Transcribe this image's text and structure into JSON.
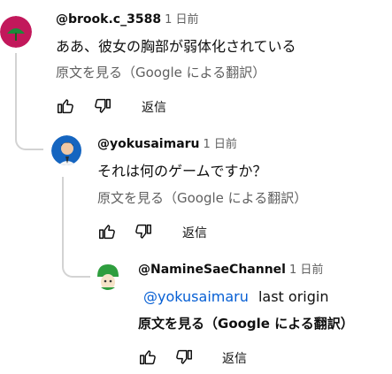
{
  "comments": [
    {
      "handle": "@brook.c_3588",
      "time": "1 日前",
      "text": "ああ、彼女の胸部が弱体化されている",
      "translate": "原文を見る（Google による翻訳）",
      "reply": "返信"
    },
    {
      "handle": "@yokusaimaru",
      "time": "1 日前",
      "text": "それは何のゲームですか？",
      "translate": "原文を見る（Google による翻訳）",
      "reply": "返信"
    },
    {
      "handle": "@NamineSaeChannel",
      "time": "1 日前",
      "mention": "@yokusaimaru",
      "text": "last origin",
      "translate": "原文を見る（Google による翻訳）",
      "reply": "返信"
    }
  ],
  "icons": {
    "like": "thumb-up-icon",
    "dislike": "thumb-down-icon"
  },
  "colors": {
    "mention": "#065fd4",
    "secondary_text": "#606060",
    "avatar1_bg": "#c2185b",
    "avatar3_bg": "#2e9e3e"
  }
}
